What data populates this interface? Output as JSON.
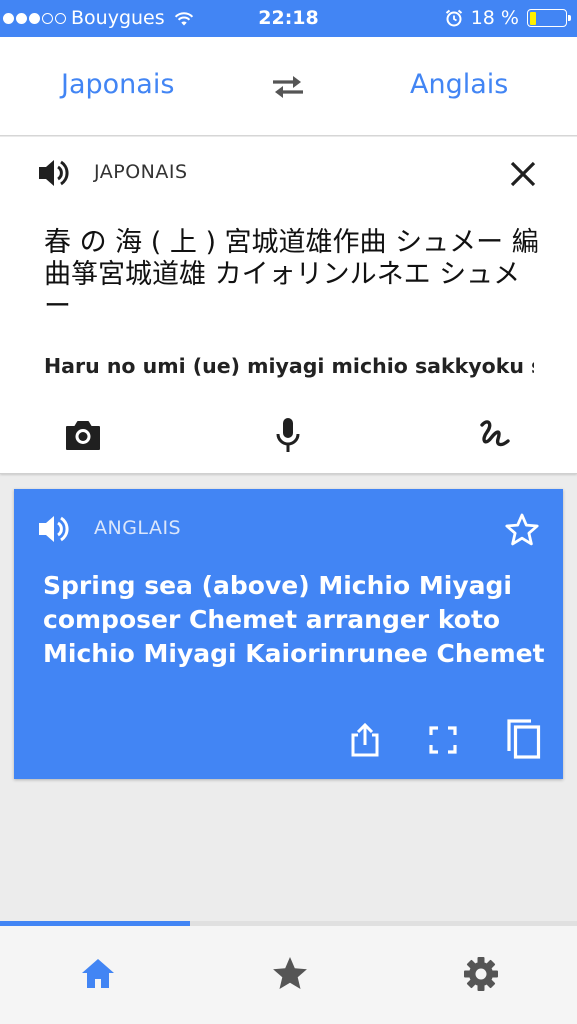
{
  "status_bar": {
    "carrier": "Bouygues",
    "time": "22:18",
    "battery_text": "18 %",
    "signal_bars_filled": 3,
    "signal_bars_total": 5,
    "battery_level": 0.18
  },
  "language_bar": {
    "source_language": "Japonais",
    "target_language": "Anglais",
    "swap_icon": "swap-arrows-icon"
  },
  "input_card": {
    "language_label": "JAPONAIS",
    "source_text": "春 の 海 ( 上 ) 宮城道雄作曲 シュメー 編曲箏宮城道雄 カイォリンルネエ シュメー",
    "transliteration": "Haru no umi (ue) miyagi michio sakkyoku shumē henkyoku",
    "icons": [
      "speaker-icon",
      "close-icon",
      "camera-icon",
      "microphone-icon",
      "handwriting-icon"
    ]
  },
  "result_card": {
    "language_label": "ANGLAIS",
    "translation": "Spring sea (above) Michio Miyagi composer Chemet arranger koto Michio Miyagi Kaiorinrunee Chemet",
    "icons": [
      "speaker-icon",
      "star-icon",
      "share-icon",
      "fullscreen-icon",
      "copy-icon"
    ]
  },
  "bottom_nav": {
    "items": [
      "home-icon",
      "star-icon",
      "settings-icon"
    ],
    "active": "home-icon",
    "progress": 0.33
  },
  "colors": {
    "accent": "#4285f4",
    "battery": "#fff000",
    "icon_dark": "#202020",
    "icon_grey": "#555555"
  }
}
